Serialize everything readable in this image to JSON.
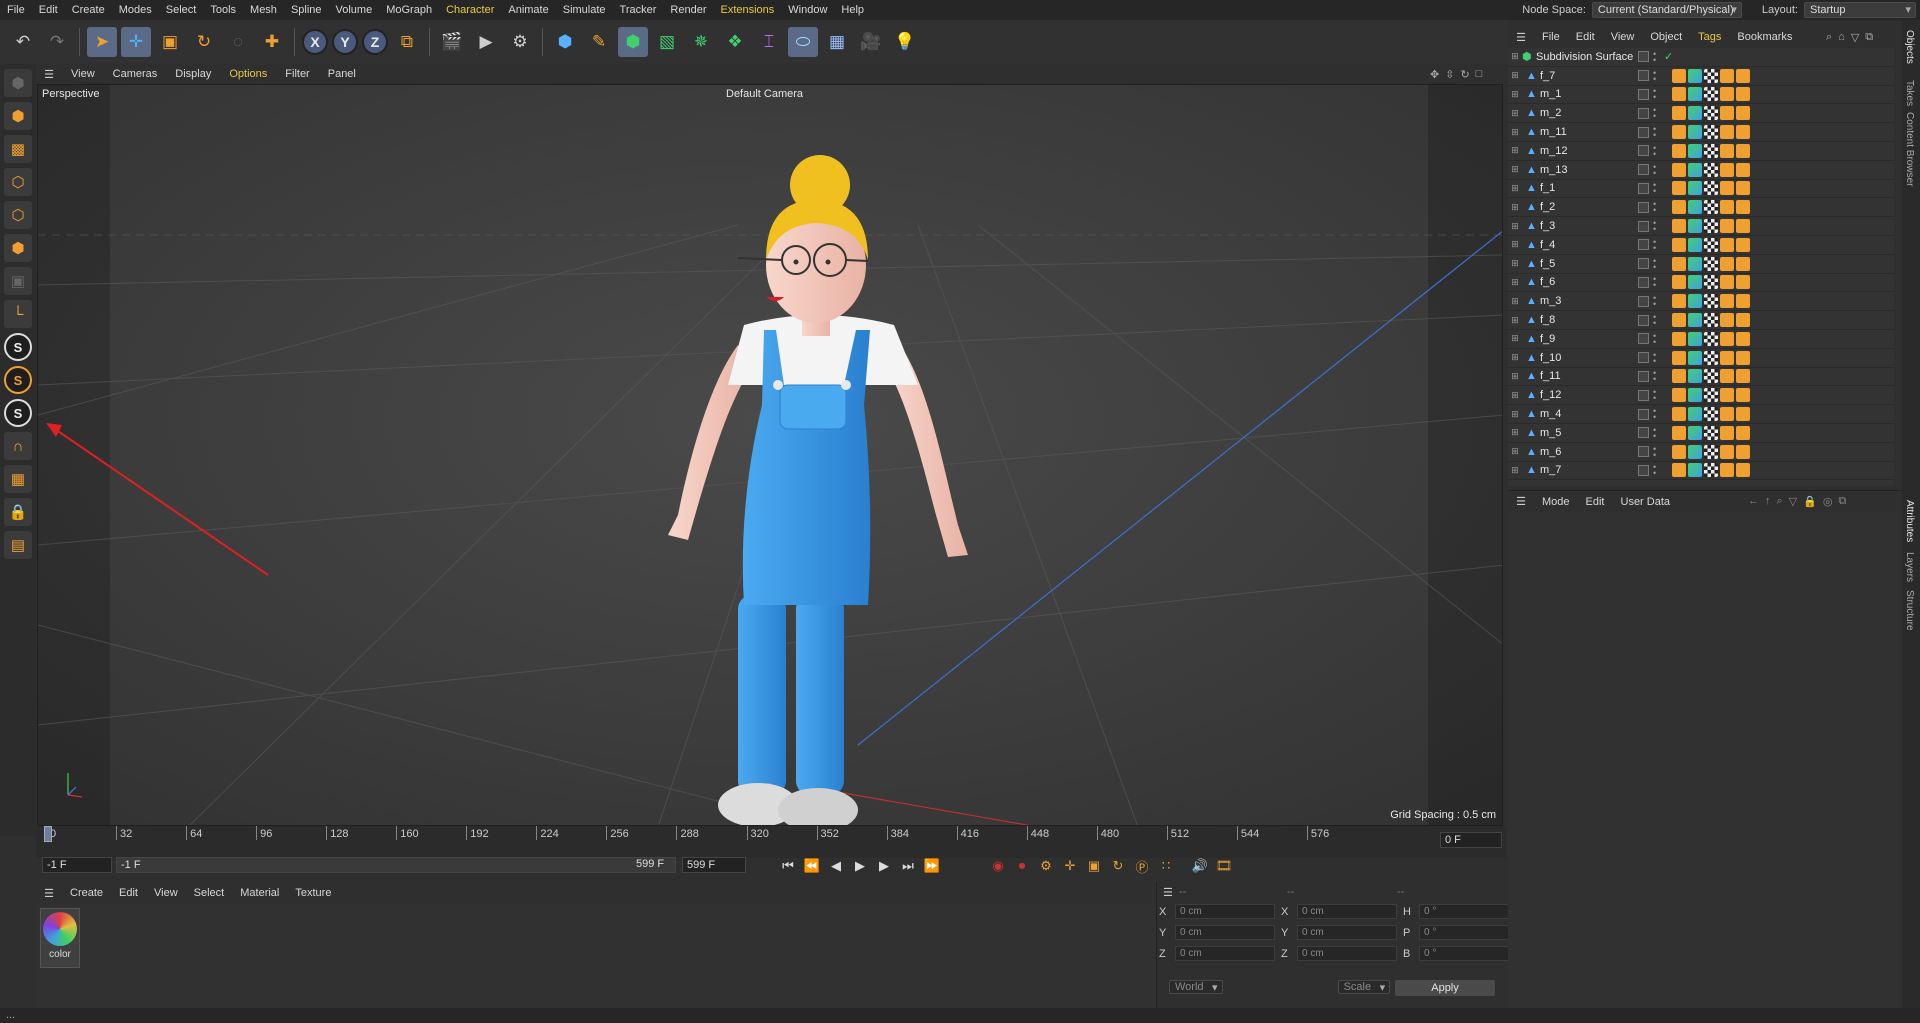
{
  "menubar": {
    "items": [
      "File",
      "Edit",
      "Create",
      "Modes",
      "Select",
      "Tools",
      "Mesh",
      "Spline",
      "Volume",
      "MoGraph",
      "Character",
      "Animate",
      "Simulate",
      "Tracker",
      "Render",
      "Extensions",
      "Window",
      "Help"
    ],
    "node_space_label": "Node Space:",
    "node_space_value": "Current (Standard/Physical)",
    "layout_label": "Layout:",
    "layout_value": "Startup"
  },
  "toolbar": {
    "icons": [
      "undo-icon",
      "redo-icon",
      "live-selection-icon",
      "move-icon",
      "scale-icon",
      "rotate-icon",
      "recent-tool-icon",
      "move-tool-icon"
    ],
    "axis_labels": [
      "X",
      "Y",
      "Z"
    ]
  },
  "viewport_menu": {
    "items": [
      "View",
      "Cameras",
      "Display",
      "Options",
      "Filter",
      "Panel"
    ],
    "highlight": "Options"
  },
  "viewport": {
    "view_name": "Perspective",
    "camera_name": "Default Camera",
    "grid_spacing": "Grid Spacing : 0.5 cm"
  },
  "timeline": {
    "ticks": [
      "0",
      "32",
      "64",
      "96",
      "128",
      "160",
      "192",
      "224",
      "256",
      "288",
      "320",
      "352",
      "384",
      "416",
      "448",
      "480",
      "512",
      "544",
      "576"
    ],
    "current_frame": "0 F",
    "start_field": "-1 F",
    "min_field": "-1 F",
    "max_field": "599 F",
    "end_field": "599 F"
  },
  "material_menu": {
    "items": [
      "Create",
      "Edit",
      "View",
      "Select",
      "Material",
      "Texture"
    ]
  },
  "material": {
    "name": "color"
  },
  "coordinates": {
    "rows": [
      {
        "a": "X",
        "av": "0 cm",
        "b": "X",
        "bv": "0 cm",
        "c": "H",
        "cv": "0 °"
      },
      {
        "a": "Y",
        "av": "0 cm",
        "b": "Y",
        "bv": "0 cm",
        "c": "P",
        "cv": "0 °"
      },
      {
        "a": "Z",
        "av": "0 cm",
        "b": "Z",
        "bv": "0 cm",
        "c": "B",
        "cv": "0 °"
      }
    ],
    "space": "World",
    "mode": "Scale",
    "apply": "Apply",
    "headers": [
      "--",
      "--",
      "--"
    ]
  },
  "object_menu": {
    "items": [
      "File",
      "Edit",
      "View",
      "Object",
      "Tags",
      "Bookmarks"
    ],
    "highlight": "Tags"
  },
  "objects": {
    "root": "Subdivision Surface",
    "items": [
      "f_7",
      "m_1",
      "m_2",
      "m_11",
      "m_12",
      "m_13",
      "f_1",
      "f_2",
      "f_3",
      "f_4",
      "f_5",
      "f_6",
      "m_3",
      "f_8",
      "f_9",
      "f_10",
      "f_11",
      "f_12",
      "m_4",
      "m_5",
      "m_6",
      "m_7"
    ]
  },
  "attributes_menu": {
    "items": [
      "Mode",
      "Edit",
      "User Data"
    ]
  },
  "right_tabs": [
    "Objects",
    "Takes",
    "Content Browser",
    "Attributes",
    "Layers",
    "Structure"
  ],
  "statusbar": {
    "text": "..."
  },
  "colors": {
    "accent": "#f0a030",
    "highlight": "#e8c94a",
    "axis_blue": "#3d6fd4",
    "axis_red": "#c03030",
    "overalls": "#3a9ae0",
    "hair": "#f0c020",
    "skin": "#f2c8bb"
  }
}
